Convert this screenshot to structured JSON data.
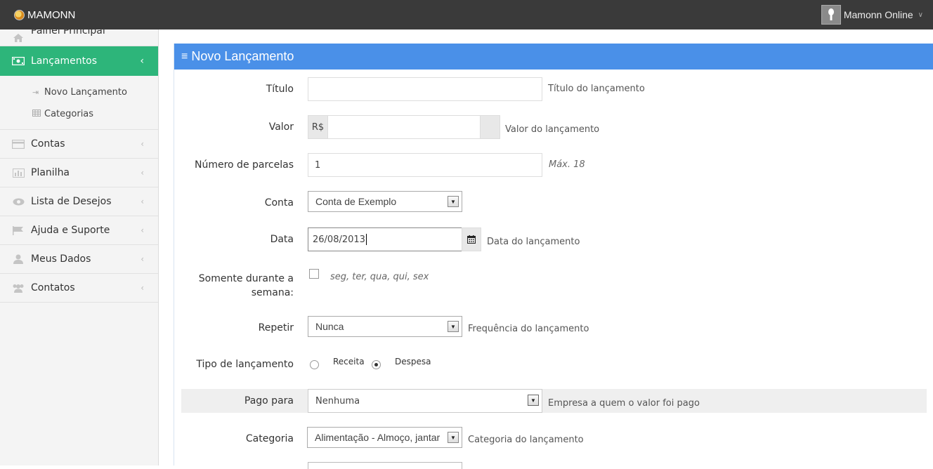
{
  "app": {
    "brand": "MAMONN",
    "user_name": "Mamonn Online"
  },
  "sidebar": {
    "items": [
      {
        "label": "Painel Principal",
        "icon": "home-icon"
      },
      {
        "label": "Lançamentos",
        "icon": "money-icon",
        "active": true
      },
      {
        "label": "Contas",
        "icon": "credit-card-icon"
      },
      {
        "label": "Planilha",
        "icon": "bar-chart-icon"
      },
      {
        "label": "Lista de Desejos",
        "icon": "eye-icon"
      },
      {
        "label": "Ajuda e Suporte",
        "icon": "flag-icon"
      },
      {
        "label": "Meus Dados",
        "icon": "user-icon"
      },
      {
        "label": "Contatos",
        "icon": "users-icon"
      }
    ],
    "submenu": [
      {
        "label": "Novo Lançamento",
        "icon": "sign-in-icon"
      },
      {
        "label": "Categorias",
        "icon": "table-icon"
      }
    ]
  },
  "form": {
    "title": "Novo Lançamento",
    "titulo": {
      "label": "Título",
      "value": "",
      "help": "Título do lançamento"
    },
    "valor": {
      "label": "Valor",
      "prefix": "R$",
      "value": "",
      "help": "Valor do lançamento"
    },
    "parcelas": {
      "label": "Número de parcelas",
      "value": "1",
      "help": "Máx. 18"
    },
    "conta": {
      "label": "Conta",
      "selected": "Conta de Exemplo"
    },
    "data": {
      "label": "Data",
      "value": "26/08/2013",
      "help": "Data do lançamento"
    },
    "semana": {
      "label_line1": "Somente durante a",
      "label_line2": "semana:",
      "checked": false,
      "help": "seg, ter, qua, qui, sex"
    },
    "repetir": {
      "label": "Repetir",
      "selected": "Nunca",
      "help": "Frequência do lançamento"
    },
    "tipo": {
      "label": "Tipo de lançamento",
      "option1": "Receita",
      "option2": "Despesa",
      "selected": "Despesa"
    },
    "pago_para": {
      "label": "Pago para",
      "selected": "Nenhuma",
      "help": "Empresa a quem o valor foi pago"
    },
    "categoria": {
      "label": "Categoria",
      "selected": "Alimentação - Almoço, jantar",
      "help": "Categoria do lançamento"
    }
  },
  "colors": {
    "topbar": "#3a3a3a",
    "active_green": "#2db57a",
    "panel_blue": "#4a90e8"
  }
}
